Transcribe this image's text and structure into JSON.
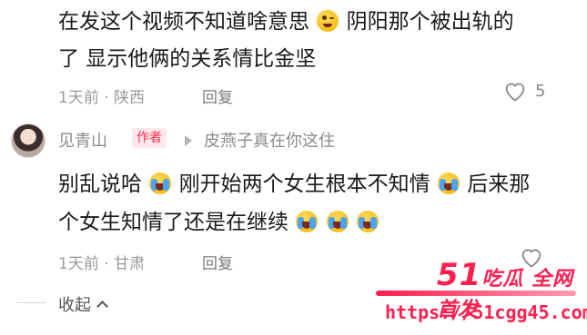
{
  "comment1": {
    "line1_text": "在发这个视频不知道啥意思",
    "line1_text_after_emoji": "阴阳那个被出轨的",
    "line2_text": "了 显示他俩的关系情比金坚",
    "time_location": "1天前 · 陕西",
    "reply_label": "回复",
    "like_count": "5",
    "emoji_icon": "wink-face-emoji"
  },
  "comment2": {
    "author_name": "见青山",
    "author_badge": "作者",
    "reply_to": "皮燕子真在你这住",
    "line1_part1": "别乱说哈",
    "line1_part2": "刚开始两个女生根本不知情",
    "line1_part3": "后来那",
    "line2_text": "个女生知情了还是在继续",
    "time_location": "1天前 · 甘肃",
    "reply_label": "回复",
    "emoji_icon": "crying-laughing-emoji"
  },
  "collapse_label": "收起",
  "watermark": {
    "brand_number": "51",
    "brand_text": "吃瓜 全网首发",
    "url": "https://51cgg45.com"
  },
  "colors": {
    "accent_red": "#ff1f4f",
    "meta_gray": "#9a9a9a"
  }
}
